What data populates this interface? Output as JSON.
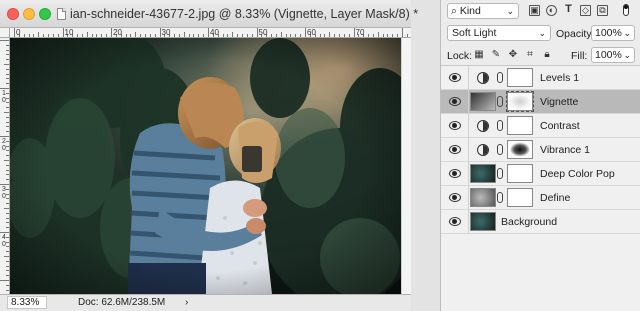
{
  "document": {
    "title": "ian-schneider-43677-2.jpg @ 8.33% (Vignette, Layer Mask/8) *",
    "ruler_labels": [
      "0",
      "10",
      "20",
      "30",
      "40",
      "50",
      "60",
      "70"
    ],
    "vruler_labels": [
      "1\n0",
      "2\n0",
      "3\n0",
      "4\n0"
    ],
    "zoom": "8.33%",
    "doc_size": "Doc: 62.6M/238.5M",
    "status_arrow": "›"
  },
  "panel": {
    "filter_kind": "Kind",
    "filter_icons": [
      "image-filter-icon",
      "adjustment-filter-icon",
      "type-filter-icon",
      "shape-filter-icon",
      "smart-object-filter-icon"
    ],
    "blend_mode": "Soft Light",
    "opacity_label": "Opacity:",
    "opacity_value": "100%",
    "lock_label": "Lock:",
    "fill_label": "Fill:",
    "fill_value": "100%",
    "layers": [
      {
        "name": "Levels 1",
        "type": "adjustment",
        "selected": false
      },
      {
        "name": "Vignette",
        "type": "gradient",
        "selected": true
      },
      {
        "name": "Contrast",
        "type": "adjustment",
        "selected": false
      },
      {
        "name": "Vibrance 1",
        "type": "adjustment",
        "selected": false
      },
      {
        "name": "Deep Color Pop",
        "type": "image",
        "selected": false
      },
      {
        "name": "Define",
        "type": "image-gray",
        "selected": false
      },
      {
        "name": "Background",
        "type": "background",
        "selected": false
      }
    ]
  },
  "colors": {
    "selected_layer": "#b9b9b9",
    "close": "#fc605c",
    "minimize": "#fdbc40",
    "maximize": "#34c84a"
  }
}
